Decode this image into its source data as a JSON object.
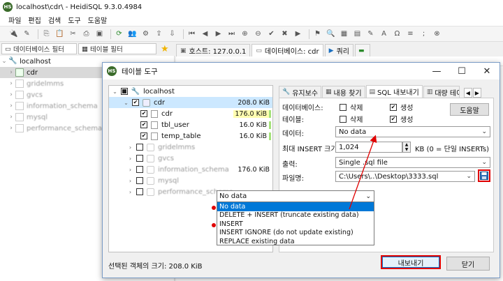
{
  "window": {
    "title": "localhost\\cdr\\ - HeidiSQL 9.3.0.4984",
    "logo_text": "HS"
  },
  "menu": [
    "파일",
    "편집",
    "검색",
    "도구",
    "도움말"
  ],
  "filters": {
    "database_filter": "데이터베이스 필터",
    "table_filter": "테이블 필터"
  },
  "main_tabs": [
    {
      "label": "호스트: 127.0.0.1"
    },
    {
      "label": "데이터베이스: cdr"
    },
    {
      "label": "쿼리"
    }
  ],
  "left_tree": {
    "root": "localhost",
    "items": [
      "cdr",
      "gridelmms",
      "gvcs",
      "information_schema",
      "mysql",
      "performance_schema"
    ]
  },
  "dialog": {
    "title": "테이블 도구",
    "tree": {
      "root": "localhost",
      "db": "cdr",
      "db_size": "208.0 KiB",
      "tables": [
        {
          "name": "cdr",
          "size": "176.0 KiB"
        },
        {
          "name": "tbl_user",
          "size": "16.0 KiB"
        },
        {
          "name": "temp_table",
          "size": "16.0 KiB"
        }
      ],
      "other_dbs": [
        {
          "name": "gridelmms",
          "size": ""
        },
        {
          "name": "gvcs",
          "size": ""
        },
        {
          "name": "information_schema",
          "size": "176.0 KiB"
        },
        {
          "name": "mysql",
          "size": ""
        },
        {
          "name": "performance_schema",
          "size": ""
        }
      ]
    },
    "tabs": [
      "유지보수",
      "내용 찾기",
      "SQL 내보내기",
      "대량 테이"
    ],
    "form": {
      "database_label": "데이터베이스:",
      "table_label": "테이블:",
      "drop_label": "삭제",
      "create_label": "생성",
      "data_label": "데이터:",
      "data_value": "No data",
      "max_insert_label": "최대 INSERT 크기:",
      "max_insert_value": "1,024",
      "max_insert_unit": "KB (0 = 단일 INSERTs)",
      "output_label": "출력:",
      "output_value": "Single .sql file",
      "filename_label": "파일명:",
      "filename_value": "C:\\Users\\..\\Desktop\\3333.sql",
      "help_button": "도움말"
    },
    "dropdown": {
      "current": "No data",
      "options": [
        "No data",
        "DELETE + INSERT (truncate existing data)",
        "INSERT",
        "INSERT IGNORE (do not update existing)",
        "REPLACE existing data"
      ]
    },
    "selected_size_text": "선택된 객체의 크기: 208.0 KiB",
    "export_button": "내보내기",
    "close_button": "닫기"
  },
  "colors": {
    "annotation_red": "#e00000",
    "selection_blue": "#0078d7"
  }
}
